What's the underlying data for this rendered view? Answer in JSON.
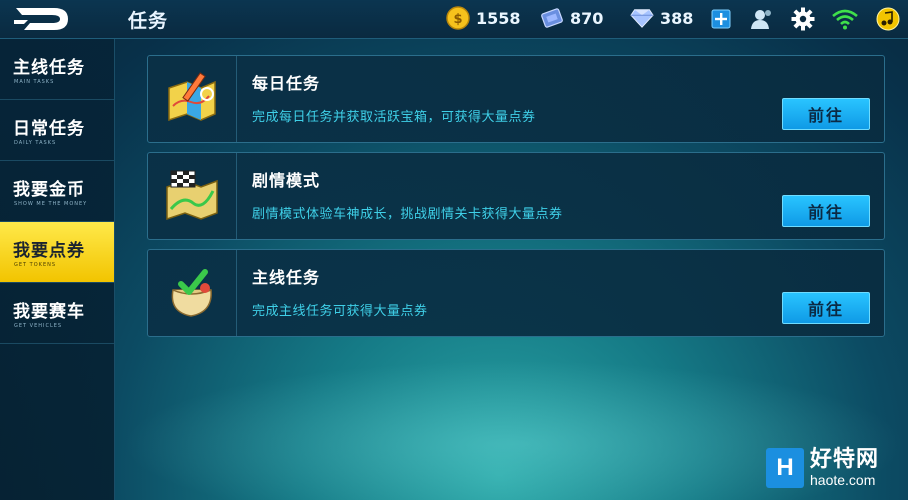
{
  "header": {
    "title": "任务",
    "resources": {
      "coins": "1558",
      "tokens": "870",
      "diamonds": "388"
    },
    "icons": [
      "logo-icon",
      "coin-icon",
      "token-icon",
      "diamond-icon",
      "plus-icon",
      "friends-icon",
      "gear-icon",
      "wifi-icon",
      "music-icon"
    ]
  },
  "sidebar": {
    "items": [
      {
        "label": "主线任务",
        "sub": "MAIN TASKS",
        "active": false
      },
      {
        "label": "日常任务",
        "sub": "DAILY TASKS",
        "active": false
      },
      {
        "label": "我要金币",
        "sub": "SHOW ME THE MONEY",
        "active": false
      },
      {
        "label": "我要点券",
        "sub": "GET TOKENS",
        "active": true
      },
      {
        "label": "我要赛车",
        "sub": "GET VEHICLES",
        "active": false
      }
    ]
  },
  "tasks": [
    {
      "name": "每日任务",
      "desc": "完成每日任务并获取活跃宝箱，可获得大量点券",
      "button": "前往",
      "icon": "map-pen-icon"
    },
    {
      "name": "剧情模式",
      "desc": "剧情模式体验车神成长，挑战剧情关卡获得大量点券",
      "button": "前往",
      "icon": "race-map-icon"
    },
    {
      "name": "主线任务",
      "desc": "完成主线任务可获得大量点券",
      "button": "前往",
      "icon": "gift-bag-icon"
    }
  ],
  "watermark": {
    "box": "H",
    "zh": "好特网",
    "url": "haote.com"
  },
  "colors": {
    "accent_yellow": "#f2c400",
    "button_blue": "#1aaef2",
    "desc_cyan": "#3fd0e8"
  }
}
